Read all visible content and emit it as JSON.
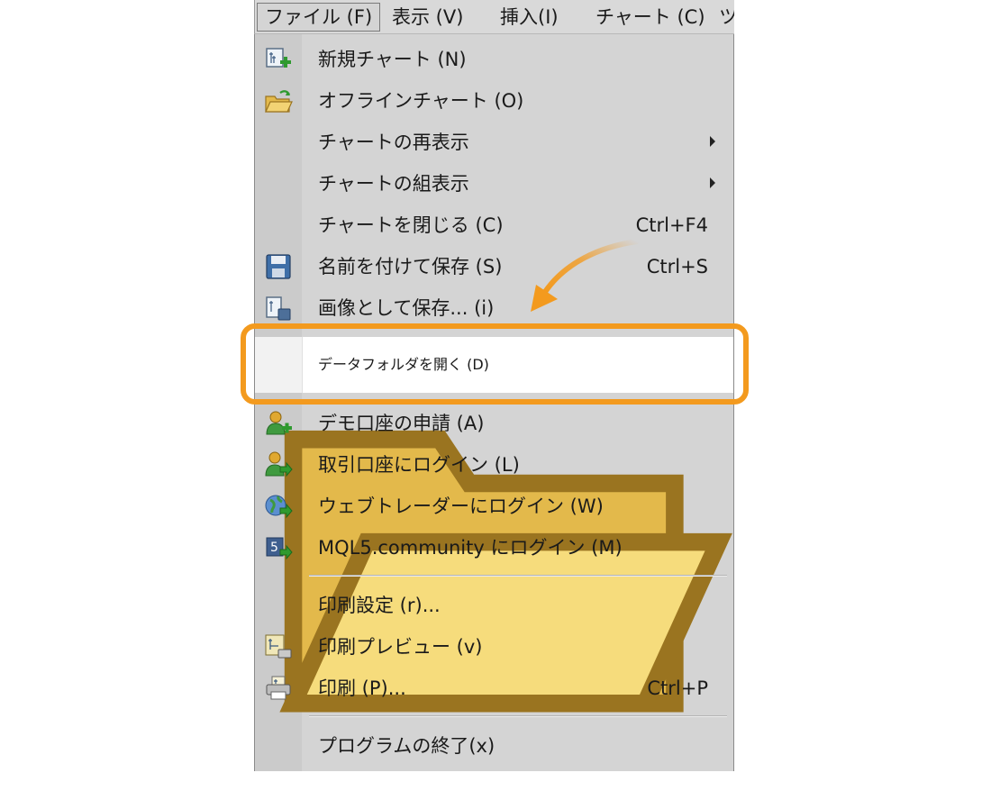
{
  "menubar": {
    "items": [
      {
        "label": "ファイル (F)",
        "active": true
      },
      {
        "label": "表示 (V)"
      },
      {
        "label": "挿入(I)"
      },
      {
        "label": "チャート (C)"
      },
      {
        "label": "ツ"
      }
    ]
  },
  "menu": {
    "items": [
      {
        "label": "新規チャート (N)",
        "shortcut": "",
        "icon": "new-chart-icon"
      },
      {
        "label": "オフラインチャート (O)",
        "shortcut": "",
        "icon": "open-folder-icon"
      },
      {
        "label": "チャートの再表示",
        "shortcut": "",
        "submenu": true
      },
      {
        "label": "チャートの組表示",
        "shortcut": "",
        "submenu": true
      },
      {
        "label": "チャートを閉じる (C)",
        "shortcut": "Ctrl+F4"
      },
      {
        "label": "名前を付けて保存 (S)",
        "shortcut": "Ctrl+S",
        "icon": "save-disk-icon"
      },
      {
        "label": "画像として保存... (i)",
        "shortcut": "",
        "icon": "save-image-icon"
      },
      {
        "label": "データフォルダを開く (D)",
        "shortcut": "",
        "icon": "folder-icon",
        "highlighted": true
      },
      {
        "label": "デモ口座の申請 (A)",
        "shortcut": "",
        "icon": "demo-account-icon"
      },
      {
        "label": "取引口座にログイン (L)",
        "shortcut": "",
        "icon": "trade-login-icon"
      },
      {
        "label": "ウェブトレーダーにログイン (W)",
        "shortcut": "",
        "icon": "web-globe-icon"
      },
      {
        "label": "MQL5.community にログイン (M)",
        "shortcut": "",
        "icon": "mql5-login-icon"
      },
      {
        "label": "印刷設定 (r)...",
        "shortcut": ""
      },
      {
        "label": "印刷プレビュー (v)",
        "shortcut": "",
        "icon": "print-preview-icon"
      },
      {
        "label": "印刷 (P)...",
        "shortcut": "Ctrl+P",
        "icon": "printer-icon"
      },
      {
        "label": "プログラムの終了(x)",
        "shortcut": ""
      }
    ]
  },
  "colors": {
    "highlight_border": "#f39a1e",
    "menu_bg": "#d4d4d4",
    "arrow": "#f39a1e"
  }
}
